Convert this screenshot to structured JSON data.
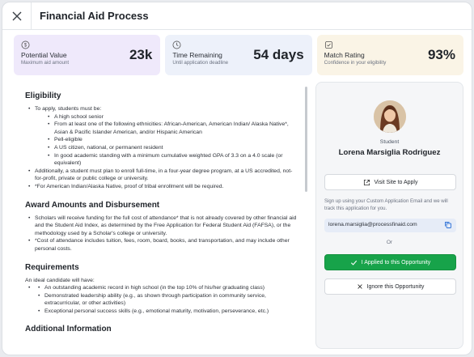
{
  "header": {
    "title": "Financial Aid Process"
  },
  "stats": [
    {
      "label": "Potential Value",
      "sub": "Maximum aid amount",
      "value": "23k",
      "icon": "dollar-circle-icon"
    },
    {
      "label": "Time Remaining",
      "sub": "Until application deadline",
      "value": "54 days",
      "icon": "clock-icon"
    },
    {
      "label": "Match Rating",
      "sub": "Confidence in your eligibility",
      "value": "93%",
      "icon": "badge-icon"
    }
  ],
  "sections": {
    "eligibility": {
      "title": "Eligibility",
      "intro": "To apply, students must be:",
      "items": [
        "A high school senior",
        "From at least one of the following ethnicities: African-American, American Indian/ Alaska Native*, Asian & Pacific Islander American, and/or Hispanic American",
        "Pell-eligible",
        "A US citizen, national, or permanent resident",
        "In good academic standing with a minimum cumulative weighted GPA of 3.3 on a 4.0 scale (or equivalent)"
      ],
      "extra": [
        "Additionally, a student must plan to enroll full-time, in a four-year degree program, at a US accredited, not-for-profit, private or public college or university.",
        "*For American Indian/Alaska Native, proof of tribal enrollment will be required."
      ]
    },
    "award": {
      "title": "Award Amounts and Disbursement",
      "items": [
        "Scholars will receive funding for the full cost of attendance* that is not already covered by other financial aid and the Student Aid Index, as determined by the Free Application for Federal Student Aid (FAFSA), or the methodology used by a Scholar's college or university.",
        "*Cost of attendance includes tuition, fees, room, board, books, and transportation, and may include other personal costs."
      ]
    },
    "requirements": {
      "title": "Requirements",
      "intro": "An ideal candidate will have:",
      "items": [
        "An outstanding academic record in high school (in the top 10% of his/her graduating class)",
        "Demonstrated leadership ability (e.g., as shown through participation in community service, extracurricular, or other activities)",
        "Exceptional personal success skills (e.g., emotional maturity, motivation, perseverance, etc.)"
      ]
    },
    "additional": {
      "title": "Additional Information"
    }
  },
  "side": {
    "role": "Student",
    "name": "Lorena Marsiglia Rodriguez",
    "visit_label": "Visit Site to Apply",
    "note": "Sign up using your Custom Application Email and we will track this application for you.",
    "email": "lorena.marsiglia@processfinaid.com",
    "or_label": "Or",
    "applied_label": "I Applied to this Opportunity",
    "ignore_label": "Ignore this Opportunity"
  }
}
